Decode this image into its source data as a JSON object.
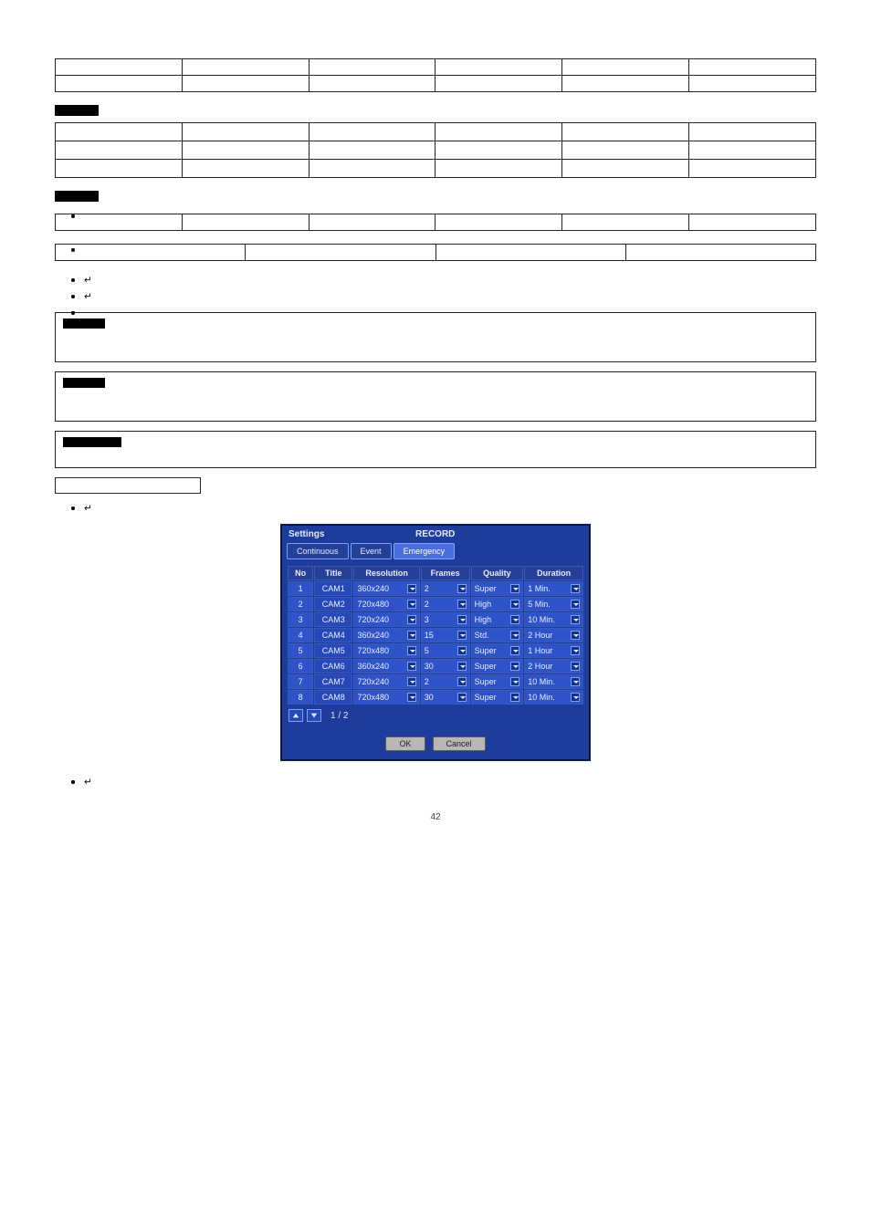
{
  "page_number": "42",
  "table_top": {
    "rows": 2,
    "cols": 6
  },
  "section_quality_label_width": 48,
  "table_quality": {
    "rows": 3,
    "cols": 6
  },
  "section_audio_label_width": 48,
  "audio_bullet1": "",
  "table_audio1": {
    "rows": 1,
    "cols": 6
  },
  "audio_bullet2": "",
  "table_audio2": {
    "rows": 1,
    "cols": 4
  },
  "audio_bullets": [
    {
      "glyph": "↵",
      "text": ""
    },
    {
      "glyph": "↵",
      "text": ""
    },
    {
      "glyph": "",
      "text": ""
    },
    {
      "glyph": "",
      "text": ""
    }
  ],
  "notes": [
    {
      "label_width": 46,
      "body": ""
    },
    {
      "label_width": 46,
      "body": ""
    },
    {
      "label_width": 64,
      "body": ""
    }
  ],
  "emergency_button_label": "",
  "emergency_bullet_glyph": "↵",
  "dvr": {
    "title_left": "Settings",
    "title_right": "RECORD",
    "tabs": [
      "Continuous",
      "Event",
      "Emergency"
    ],
    "active_tab_index": 2,
    "columns": [
      "No",
      "Title",
      "Resolution",
      "Frames",
      "Quality",
      "Duration"
    ],
    "rows": [
      {
        "no": "1",
        "title": "CAM1",
        "resolution": "360x240",
        "frames": "2",
        "quality": "Super",
        "duration": "1 Min."
      },
      {
        "no": "2",
        "title": "CAM2",
        "resolution": "720x480",
        "frames": "2",
        "quality": "High",
        "duration": "5 Min."
      },
      {
        "no": "3",
        "title": "CAM3",
        "resolution": "720x240",
        "frames": "3",
        "quality": "High",
        "duration": "10 Min."
      },
      {
        "no": "4",
        "title": "CAM4",
        "resolution": "360x240",
        "frames": "15",
        "quality": "Std.",
        "duration": "2 Hour"
      },
      {
        "no": "5",
        "title": "CAM5",
        "resolution": "720x480",
        "frames": "5",
        "quality": "Super",
        "duration": "1 Hour"
      },
      {
        "no": "6",
        "title": "CAM6",
        "resolution": "360x240",
        "frames": "30",
        "quality": "Super",
        "duration": "2 Hour"
      },
      {
        "no": "7",
        "title": "CAM7",
        "resolution": "720x240",
        "frames": "2",
        "quality": "Super",
        "duration": "10 Min."
      },
      {
        "no": "8",
        "title": "CAM8",
        "resolution": "720x480",
        "frames": "30",
        "quality": "Super",
        "duration": "10 Min."
      }
    ],
    "pager": "1 / 2",
    "ok": "OK",
    "cancel": "Cancel"
  },
  "bottom_bullets": [
    {
      "glyph": "",
      "text": ""
    },
    {
      "glyph": "",
      "text": ""
    },
    {
      "glyph": "↵",
      "text": ""
    }
  ]
}
